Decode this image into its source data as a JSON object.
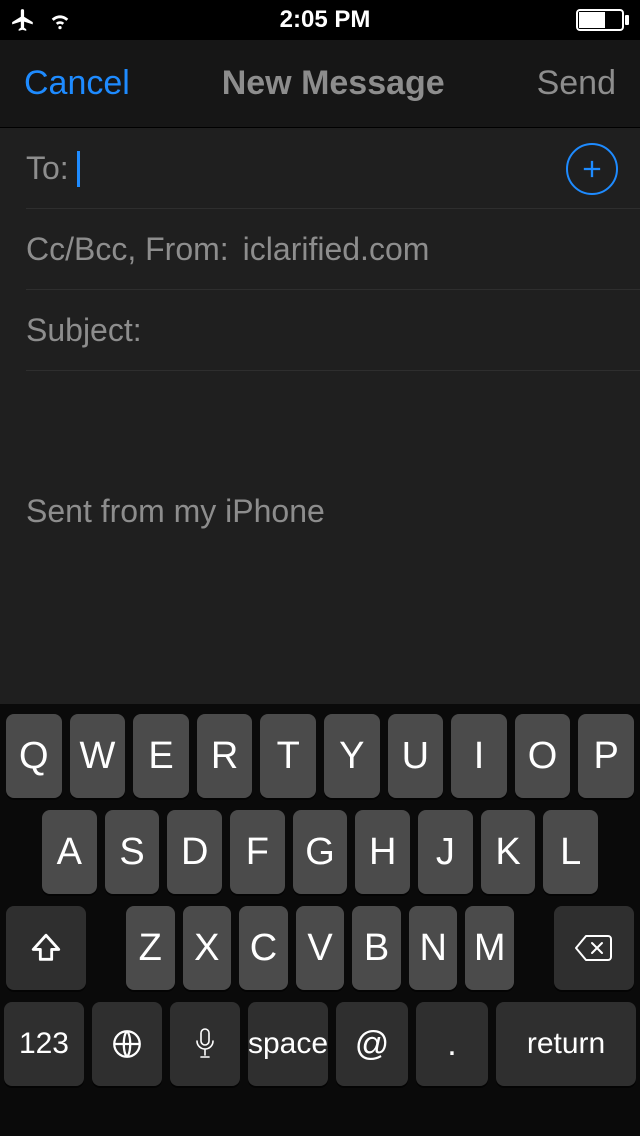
{
  "status": {
    "time": "2:05 PM"
  },
  "nav": {
    "cancel": "Cancel",
    "title": "New Message",
    "send": "Send"
  },
  "compose": {
    "to_label": "To:",
    "to_value": "",
    "ccbcc_label": "Cc/Bcc, From:",
    "from_value": "iclarified.com",
    "subject_label": "Subject:",
    "subject_value": "",
    "signature": "Sent from my iPhone"
  },
  "keyboard": {
    "row1": [
      "Q",
      "W",
      "E",
      "R",
      "T",
      "Y",
      "U",
      "I",
      "O",
      "P"
    ],
    "row2": [
      "A",
      "S",
      "D",
      "F",
      "G",
      "H",
      "J",
      "K",
      "L"
    ],
    "row3": [
      "Z",
      "X",
      "C",
      "V",
      "B",
      "N",
      "M"
    ],
    "k123": "123",
    "space": "space",
    "at": "@",
    "dot": ".",
    "ret": "return"
  }
}
